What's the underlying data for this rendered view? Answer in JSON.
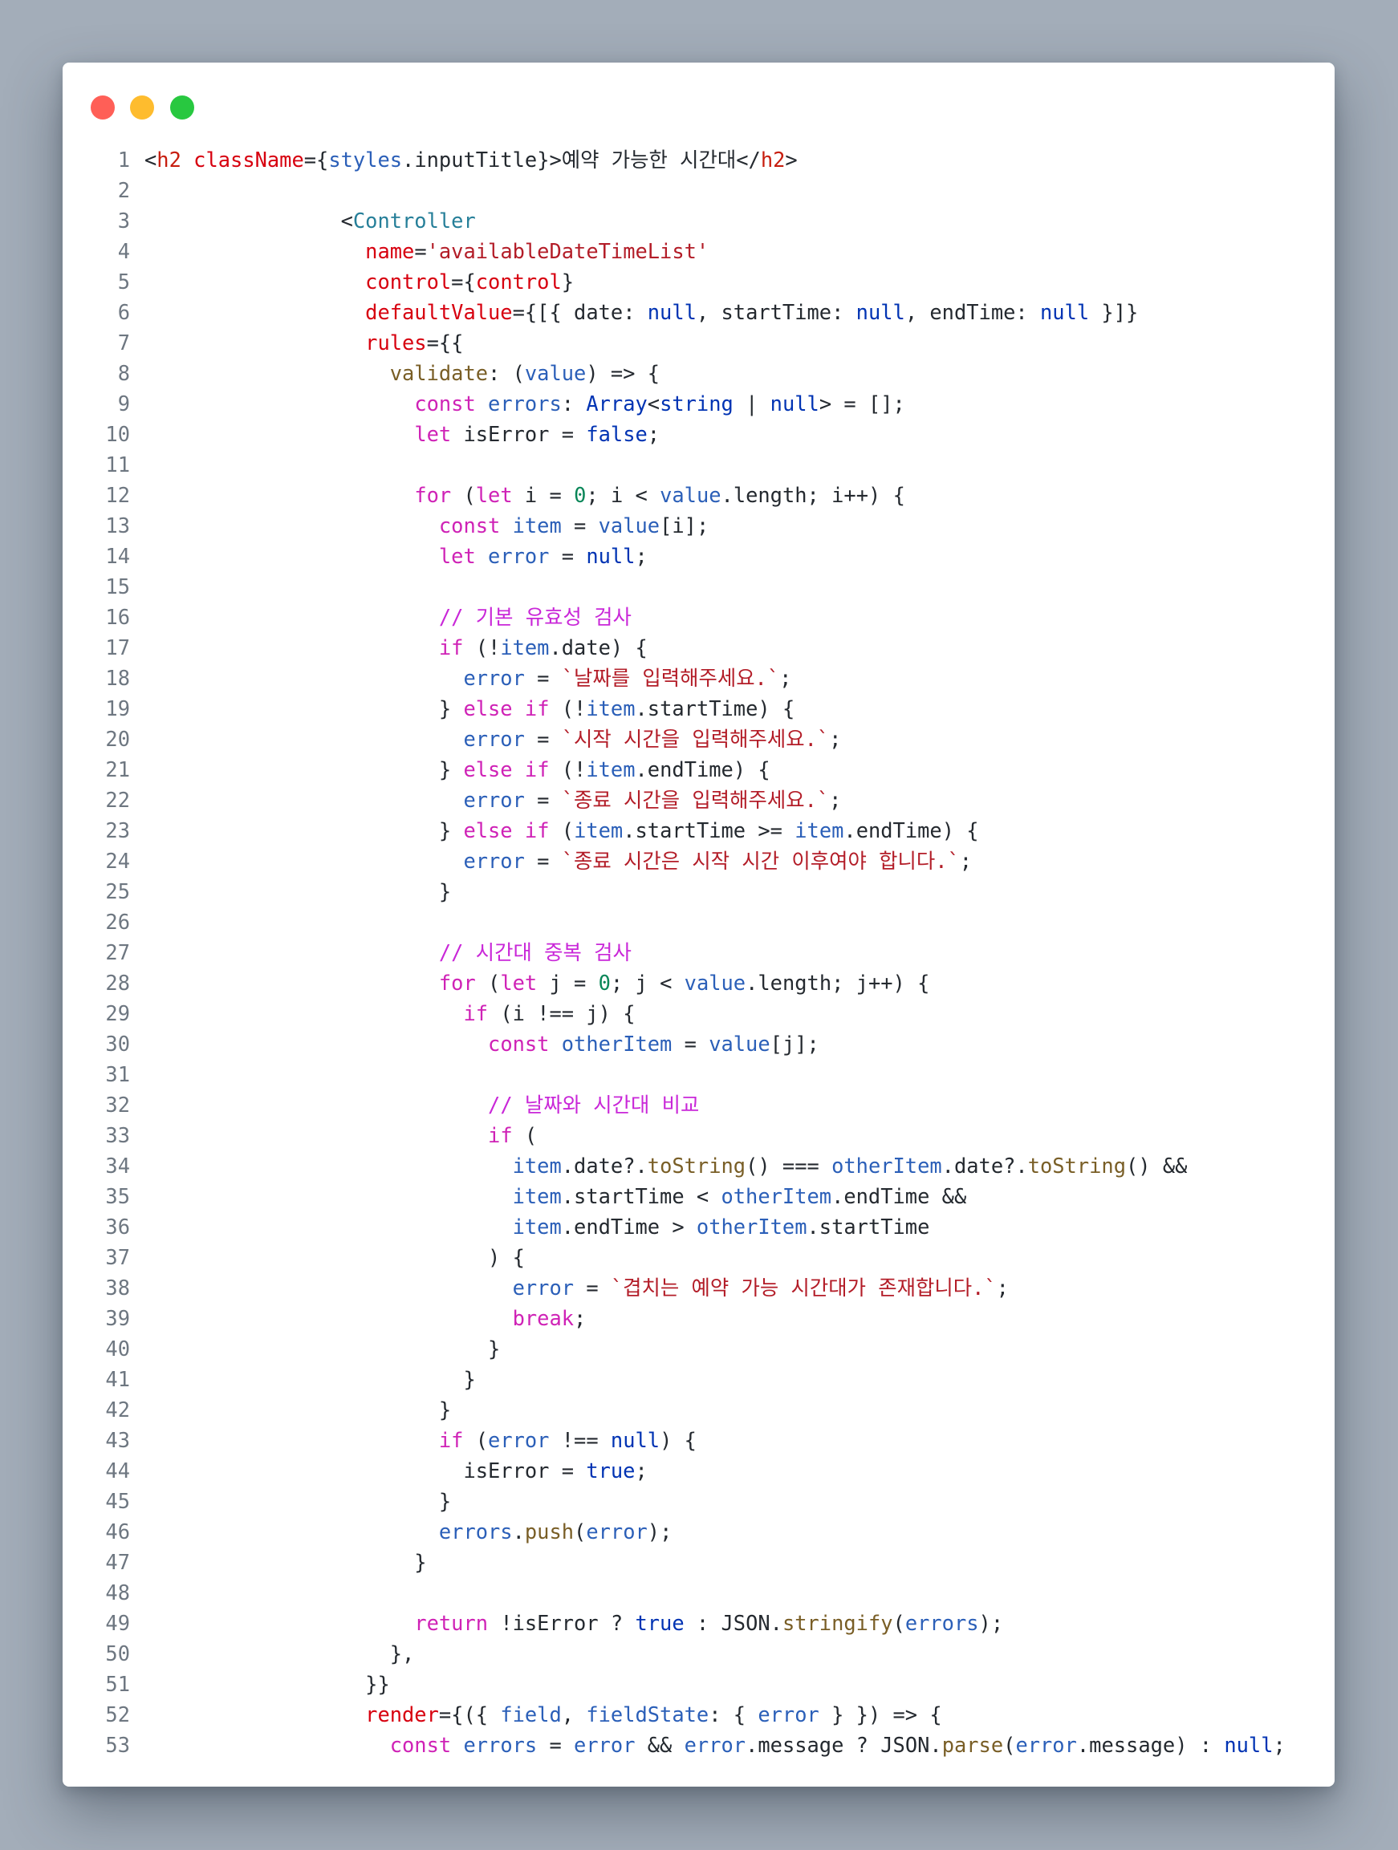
{
  "window": {
    "controls": [
      "close",
      "minimize",
      "maximize"
    ],
    "colors": {
      "close": "#ff5f57",
      "minimize": "#febc2e",
      "maximize": "#28c840",
      "background": "#a3adb9"
    }
  },
  "code": {
    "language": "tsx",
    "lines": [
      "<h2 className={styles.inputTitle}>예약 가능한 시간대</h2>",
      "",
      "                <Controller",
      "                  name='availableDateTimeList'",
      "                  control={control}",
      "                  defaultValue={[{ date: null, startTime: null, endTime: null }]}",
      "                  rules={{",
      "                    validate: (value) => {",
      "                      const errors: Array<string | null> = [];",
      "                      let isError = false;",
      "",
      "                      for (let i = 0; i < value.length; i++) {",
      "                        const item = value[i];",
      "                        let error = null;",
      "",
      "                        // 기본 유효성 검사",
      "                        if (!item.date) {",
      "                          error = `날짜를 입력해주세요.`;",
      "                        } else if (!item.startTime) {",
      "                          error = `시작 시간을 입력해주세요.`;",
      "                        } else if (!item.endTime) {",
      "                          error = `종료 시간을 입력해주세요.`;",
      "                        } else if (item.startTime >= item.endTime) {",
      "                          error = `종료 시간은 시작 시간 이후여야 합니다.`;",
      "                        }",
      "",
      "                        // 시간대 중복 검사",
      "                        for (let j = 0; j < value.length; j++) {",
      "                          if (i !== j) {",
      "                            const otherItem = value[j];",
      "",
      "                            // 날짜와 시간대 비교",
      "                            if (",
      "                              item.date?.toString() === otherItem.date?.toString() &&",
      "                              item.startTime < otherItem.endTime &&",
      "                              item.endTime > otherItem.startTime",
      "                            ) {",
      "                              error = `겹치는 예약 가능 시간대가 존재합니다.`;",
      "                              break;",
      "                            }",
      "                          }",
      "                        }",
      "                        if (error !== null) {",
      "                          isError = true;",
      "                        }",
      "                        errors.push(error);",
      "                      }",
      "",
      "                      return !isError ? true : JSON.stringify(errors);",
      "                    },",
      "                  }}",
      "                  render={({ field, fieldState: { error } }) => {",
      "                    const errors = error && error.message ? JSON.parse(error.message) : null;"
    ]
  }
}
